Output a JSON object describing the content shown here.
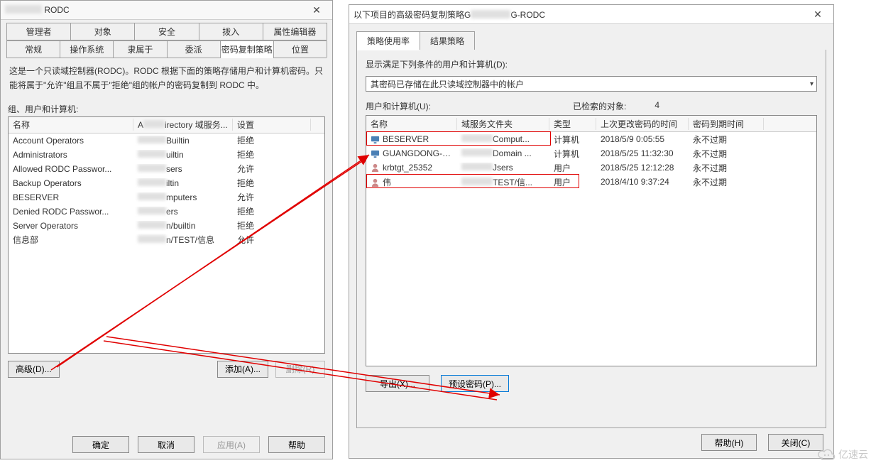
{
  "left": {
    "title_prefix": "",
    "title_suffix": "RODC",
    "close": "✕",
    "tabs_row1": [
      "管理者",
      "对象",
      "安全",
      "拨入",
      "属性编辑器"
    ],
    "tabs_row2": [
      "常规",
      "操作系统",
      "隶属于",
      "委派",
      "密码复制策略",
      "位置"
    ],
    "active_row": 2,
    "active_index": 4,
    "description": "这是一个只读域控制器(RODC)。RODC 根据下面的策略存储用户和计算机密码。只能将属于\"允许\"组且不属于\"拒绝\"组的帐户的密码复制到 RODC 中。",
    "group_label": "组、用户和计算机:",
    "columns": [
      "名称",
      "Active Directory 域服务...",
      "设置"
    ],
    "col_mid_prefix": "A",
    "col_mid_suffix": "irectory 域服务...",
    "rows": [
      {
        "name": "Account Operators",
        "folder_suffix": "Builtin",
        "setting": "拒绝"
      },
      {
        "name": "Administrators",
        "folder_suffix": "uiltin",
        "setting": "拒绝"
      },
      {
        "name": "Allowed RODC Passwor...",
        "folder_suffix": "sers",
        "setting": "允许"
      },
      {
        "name": "Backup Operators",
        "folder_suffix": "iltin",
        "setting": "拒绝"
      },
      {
        "name": "BESERVER",
        "folder_suffix": "mputers",
        "setting": "允许"
      },
      {
        "name": "Denied RODC Passwor...",
        "folder_suffix": "ers",
        "setting": "拒绝"
      },
      {
        "name": "Server Operators",
        "folder_suffix": "n/builtin",
        "setting": "拒绝"
      },
      {
        "name": "信息部",
        "folder_suffix": "n/TEST/信息",
        "setting": "允许"
      }
    ],
    "buttons": {
      "advanced": "高级(D)...",
      "add": "添加(A)...",
      "remove": "删除(R)"
    },
    "footer": {
      "ok": "确定",
      "cancel": "取消",
      "apply": "应用(A)",
      "help": "帮助"
    }
  },
  "right": {
    "title_prefix": "以下项目的高级密码复制策略G",
    "title_suffix": "G-RODC",
    "close": "✕",
    "tabs": [
      "策略使用率",
      "结果策略"
    ],
    "active_index": 0,
    "subtitle": "显示满足下列条件的用户和计算机(D):",
    "dropdown_value": "其密码已存储在此只读域控制器中的帐户",
    "list_label": "用户和计算机(U):",
    "count_label": "已检索的对象:",
    "count_value": "4",
    "columns": [
      "名称",
      "域服务文件夹",
      "类型",
      "上次更改密码的时间",
      "密码到期时间"
    ],
    "rows": [
      {
        "icon": "computer",
        "name": "BESERVER",
        "folder_suffix": "Comput...",
        "type": "计算机",
        "time": "2018/5/9 0:05:55",
        "expire": "永不过期"
      },
      {
        "icon": "computer",
        "name": "GUANGDONG-R...",
        "folder_suffix": "Domain ...",
        "type": "计算机",
        "time": "2018/5/25 11:32:30",
        "expire": "永不过期"
      },
      {
        "icon": "user",
        "name": "krbtgt_25352",
        "folder_suffix": "Jsers",
        "type": "用户",
        "time": "2018/5/25 12:12:28",
        "expire": "永不过期"
      },
      {
        "icon": "user",
        "name": "伟",
        "folder_suffix": "TEST/信...",
        "type": "用户",
        "time": "2018/4/10 9:37:24",
        "expire": "永不过期"
      }
    ],
    "buttons": {
      "export": "导出(X)...",
      "preset": "预设密码(P)..."
    },
    "footer": {
      "help": "帮助(H)",
      "close": "关闭(C)"
    }
  },
  "watermark": "亿速云"
}
